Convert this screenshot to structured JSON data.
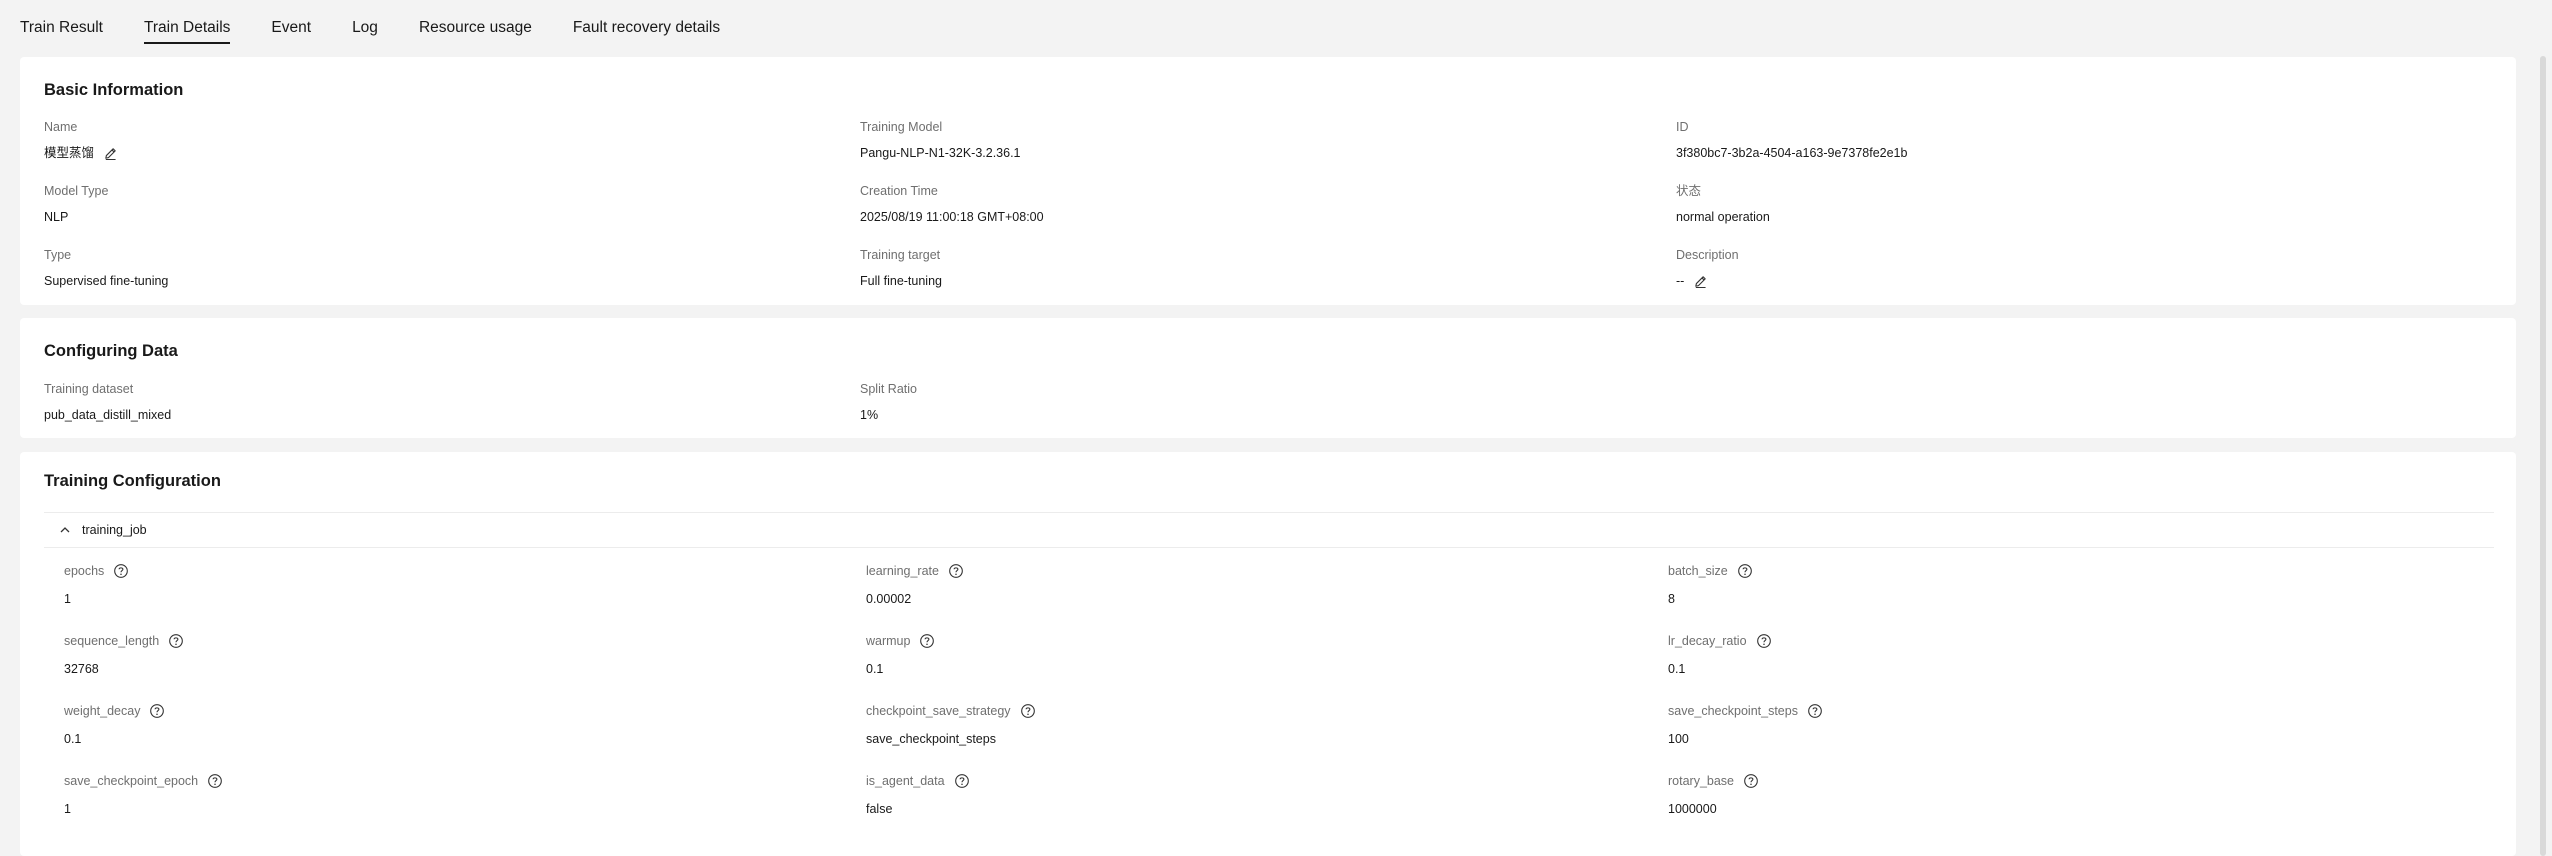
{
  "tabs": [
    {
      "label": "Train Result",
      "active": false
    },
    {
      "label": "Train Details",
      "active": true
    },
    {
      "label": "Event",
      "active": false
    },
    {
      "label": "Log",
      "active": false
    },
    {
      "label": "Resource usage",
      "active": false
    },
    {
      "label": "Fault recovery details",
      "active": false
    }
  ],
  "basic": {
    "title": "Basic Information",
    "name": {
      "label": "Name",
      "value": "模型蒸馏"
    },
    "training_model": {
      "label": "Training Model",
      "value": "Pangu-NLP-N1-32K-3.2.36.1"
    },
    "id": {
      "label": "ID",
      "value": "3f380bc7-3b2a-4504-a163-9e7378fe2e1b"
    },
    "model_type": {
      "label": "Model Type",
      "value": "NLP"
    },
    "creation_time": {
      "label": "Creation Time",
      "value": "2025/08/19 11:00:18 GMT+08:00"
    },
    "status": {
      "label": "状态",
      "value": "normal operation"
    },
    "type": {
      "label": "Type",
      "value": "Supervised fine-tuning"
    },
    "training_target": {
      "label": "Training target",
      "value": "Full fine-tuning"
    },
    "description": {
      "label": "Description",
      "value": "--"
    }
  },
  "config_data": {
    "title": "Configuring Data",
    "dataset": {
      "label": "Training dataset",
      "value": "pub_data_distill_mixed"
    },
    "split_ratio": {
      "label": "Split Ratio",
      "value": "1%"
    }
  },
  "training_config": {
    "title": "Training Configuration",
    "section_title": "training_job",
    "params": [
      {
        "label": "epochs",
        "value": "1"
      },
      {
        "label": "learning_rate",
        "value": "0.00002"
      },
      {
        "label": "batch_size",
        "value": "8"
      },
      {
        "label": "sequence_length",
        "value": "32768"
      },
      {
        "label": "warmup",
        "value": "0.1"
      },
      {
        "label": "lr_decay_ratio",
        "value": "0.1"
      },
      {
        "label": "weight_decay",
        "value": "0.1"
      },
      {
        "label": "checkpoint_save_strategy",
        "value": "save_checkpoint_steps"
      },
      {
        "label": "save_checkpoint_steps",
        "value": "100"
      },
      {
        "label": "save_checkpoint_epoch",
        "value": "1"
      },
      {
        "label": "is_agent_data",
        "value": "false"
      },
      {
        "label": "rotary_base",
        "value": "1000000"
      }
    ]
  },
  "icons": {
    "edit": "edit-pencil-icon",
    "help": "question-circle-icon",
    "collapse": "chevron-up-icon"
  }
}
